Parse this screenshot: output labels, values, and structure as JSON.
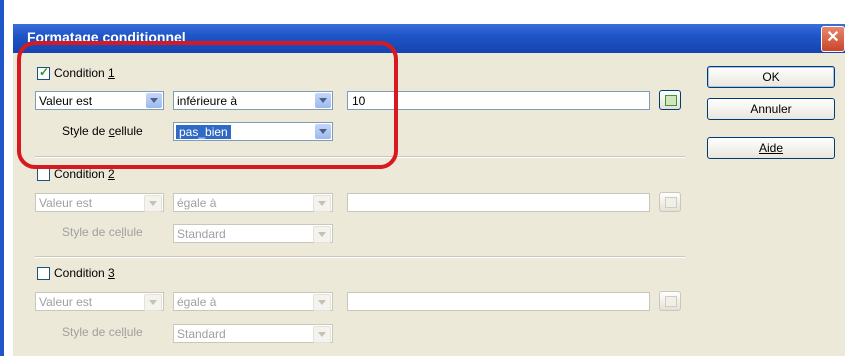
{
  "window": {
    "title": "Formatage conditionnel",
    "close": "✕"
  },
  "conditions": [
    {
      "label_pre": "Condition ",
      "label_key": "1",
      "checked": true,
      "value_type": "Valeur est",
      "operator": "inférieure à",
      "value": "10",
      "style_label_pre": "Style de ",
      "style_label_key": "c",
      "style_label_post": "ellule",
      "style": "pas_bien"
    },
    {
      "label_pre": "Condition ",
      "label_key": "2",
      "checked": false,
      "value_type": "Valeur est",
      "operator": "égale à",
      "value": "",
      "style_label_pre": "Style de ce",
      "style_label_key": "l",
      "style_label_post": "lule",
      "style": "Standard"
    },
    {
      "label_pre": "Condition ",
      "label_key": "3",
      "checked": false,
      "value_type": "Valeur est",
      "operator": "égale à",
      "value": "",
      "style_label_pre": "Style de cel",
      "style_label_key": "l",
      "style_label_post": "ule",
      "style": "Standard"
    }
  ],
  "buttons": {
    "ok": "OK",
    "cancel": "Annuler",
    "help": "Aide"
  },
  "highlight_color": "#d81921"
}
